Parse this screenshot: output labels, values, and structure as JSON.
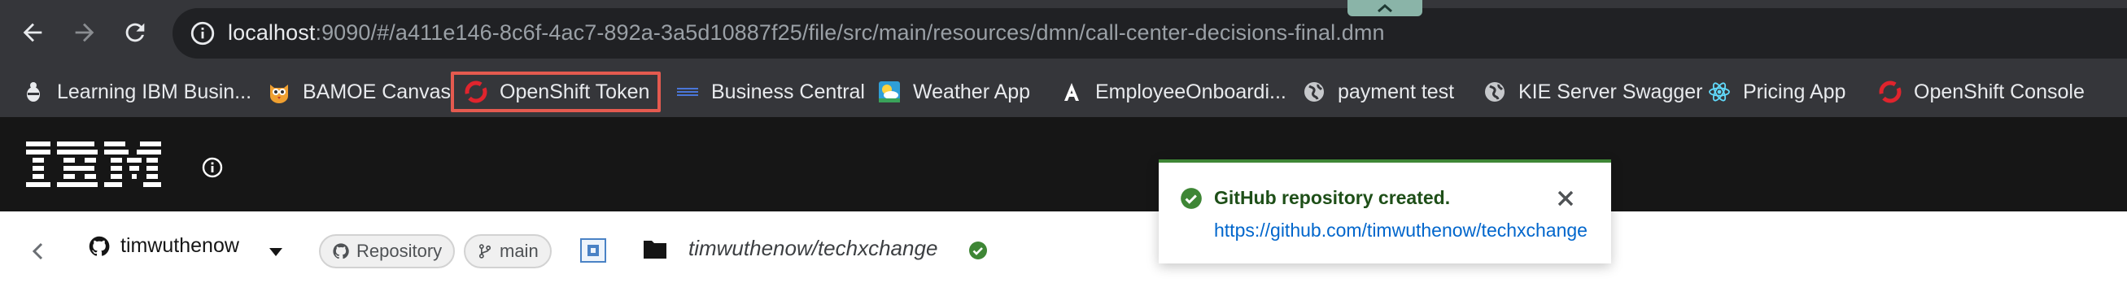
{
  "browser": {
    "url_host": "localhost",
    "url_rest": ":9090/#/a411e146-8c6f-4ac7-892a-3a5d10887f25/file/src/main/resources/dmn/call-center-decisions-final.dmn"
  },
  "bookmarks": [
    {
      "label": "Learning IBM Busin...",
      "icon": "ibm-bee-icon"
    },
    {
      "label": "BAMOE Canvas",
      "icon": "kie-owl-icon"
    },
    {
      "label": "OpenShift Token",
      "icon": "openshift-icon",
      "highlighted": true
    },
    {
      "label": "Business Central",
      "icon": "ibm-logo-icon"
    },
    {
      "label": "Weather App",
      "icon": "weather-icon"
    },
    {
      "label": "EmployeeOnboardi...",
      "icon": "letter-a-icon"
    },
    {
      "label": "payment test",
      "icon": "globe-icon"
    },
    {
      "label": "KIE Server Swagger",
      "icon": "globe-icon"
    },
    {
      "label": "Pricing App",
      "icon": "react-icon"
    },
    {
      "label": "OpenShift Console",
      "icon": "openshift-icon"
    }
  ],
  "header": {
    "logo": "IBM"
  },
  "repo_bar": {
    "account": "timwuthenow",
    "repository_label": "Repository",
    "branch": "main",
    "repo_path": "timwuthenow/techxchange"
  },
  "toast": {
    "title": "GitHub repository created.",
    "link": "https://github.com/timwuthenow/techxchange"
  },
  "colors": {
    "success": "#3e8635",
    "link": "#0066cc",
    "highlight": "#e45a4f",
    "masthead": "#161616"
  }
}
